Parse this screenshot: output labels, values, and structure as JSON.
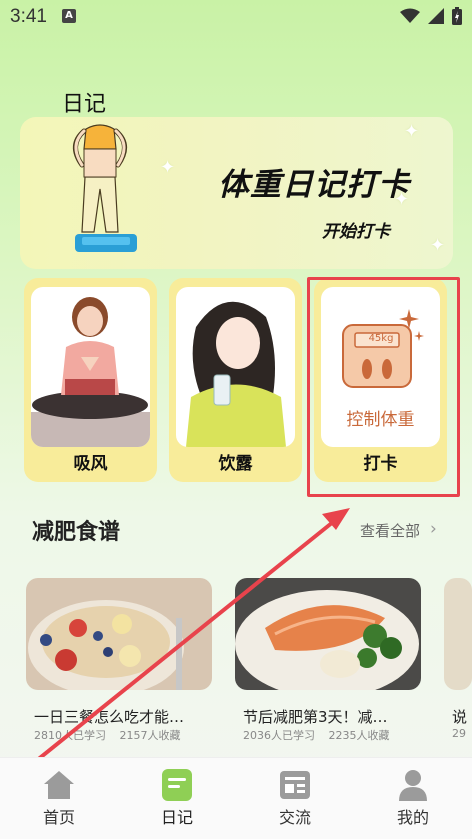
{
  "status_bar": {
    "time": "3:41",
    "a_badge": "A"
  },
  "header": {
    "title": "日记"
  },
  "banner": {
    "title": "体重日记打卡",
    "subtitle": "开始打卡"
  },
  "cards": [
    {
      "label": "吸风"
    },
    {
      "label": "饮露"
    },
    {
      "label": "打卡",
      "scale_display": "45kg",
      "scale_caption": "控制体重"
    }
  ],
  "recipes_section": {
    "title": "减肥食谱",
    "view_all": "查看全部"
  },
  "recipes": [
    {
      "title": "一日三餐怎么吃才能…",
      "learners": "2810人已学习",
      "favorites": "2157人收藏"
    },
    {
      "title": "节后减肥第3天！减…",
      "learners": "2036人已学习",
      "favorites": "2235人收藏"
    },
    {
      "title": "说",
      "learners": "29"
    }
  ],
  "bottom_nav": [
    {
      "label": "首页",
      "icon": "home-icon"
    },
    {
      "label": "日记",
      "icon": "diary-icon",
      "active": true
    },
    {
      "label": "交流",
      "icon": "news-icon"
    },
    {
      "label": "我的",
      "icon": "profile-icon"
    }
  ],
  "colors": {
    "accent_green": "#8fcf55",
    "card_yellow": "#f8ec9a",
    "highlight_red": "#e8434c"
  }
}
